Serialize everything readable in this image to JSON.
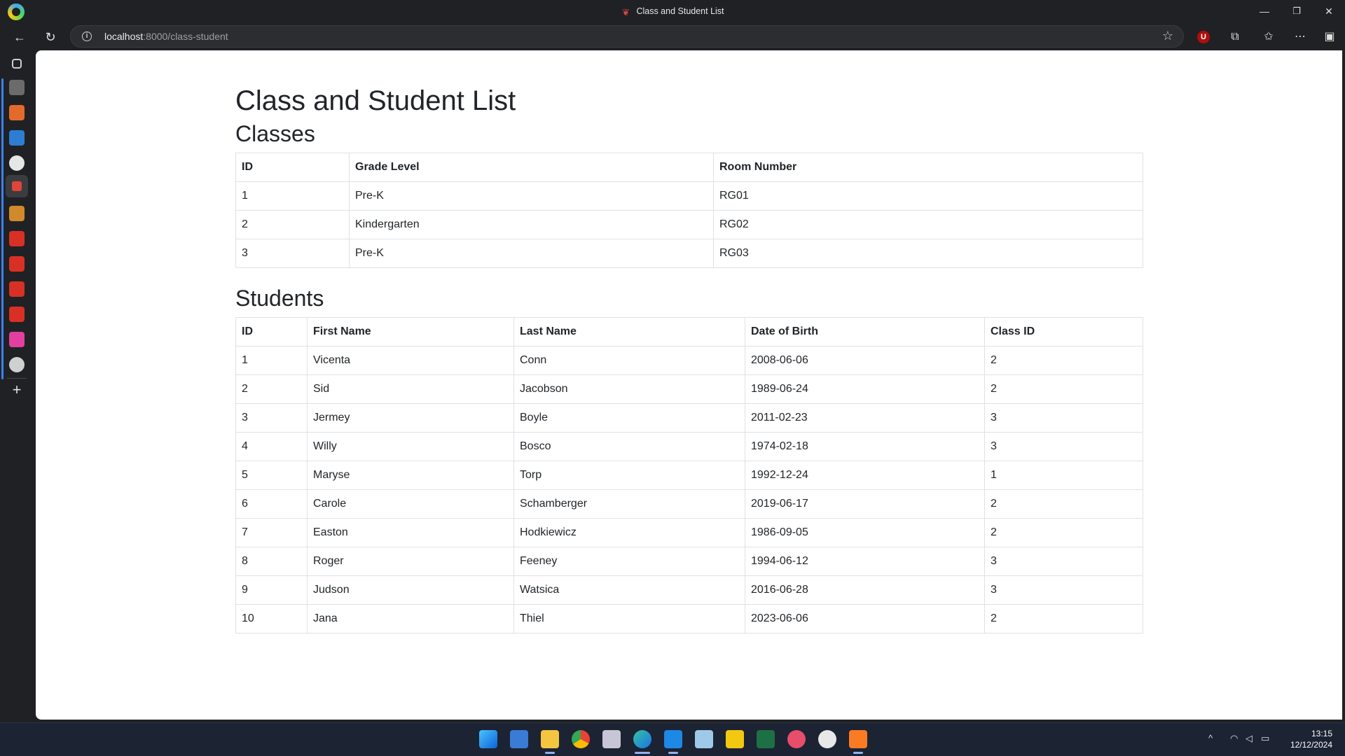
{
  "window": {
    "title": "Class and Student List",
    "minimize": "—",
    "restore": "❐",
    "close": "✕"
  },
  "address_bar": {
    "host": "localhost",
    "path": ":8000/class-student"
  },
  "page": {
    "title": "Class and Student List",
    "classes_heading": "Classes",
    "students_heading": "Students"
  },
  "classes": {
    "headers": [
      "ID",
      "Grade Level",
      "Room Number"
    ],
    "rows": [
      [
        "1",
        "Pre-K",
        "RG01"
      ],
      [
        "2",
        "Kindergarten",
        "RG02"
      ],
      [
        "3",
        "Pre-K",
        "RG03"
      ]
    ]
  },
  "students": {
    "headers": [
      "ID",
      "First Name",
      "Last Name",
      "Date of Birth",
      "Class ID"
    ],
    "rows": [
      [
        "1",
        "Vicenta",
        "Conn",
        "2008-06-06",
        "2"
      ],
      [
        "2",
        "Sid",
        "Jacobson",
        "1989-06-24",
        "2"
      ],
      [
        "3",
        "Jermey",
        "Boyle",
        "2011-02-23",
        "3"
      ],
      [
        "4",
        "Willy",
        "Bosco",
        "1974-02-18",
        "3"
      ],
      [
        "5",
        "Maryse",
        "Torp",
        "1992-12-24",
        "1"
      ],
      [
        "6",
        "Carole",
        "Schamberger",
        "2019-06-17",
        "2"
      ],
      [
        "7",
        "Easton",
        "Hodkiewicz",
        "1986-09-05",
        "2"
      ],
      [
        "8",
        "Roger",
        "Feeney",
        "1994-06-12",
        "3"
      ],
      [
        "9",
        "Judson",
        "Watsica",
        "2016-06-28",
        "3"
      ],
      [
        "10",
        "Jana",
        "Thiel",
        "2023-06-06",
        "2"
      ]
    ]
  },
  "taskbar": {
    "time": "13:15",
    "date": "12/12/2024"
  },
  "colors": {
    "browser_chrome": "#202124",
    "table_border": "#dee2e6",
    "taskbar": "#1c2333"
  }
}
